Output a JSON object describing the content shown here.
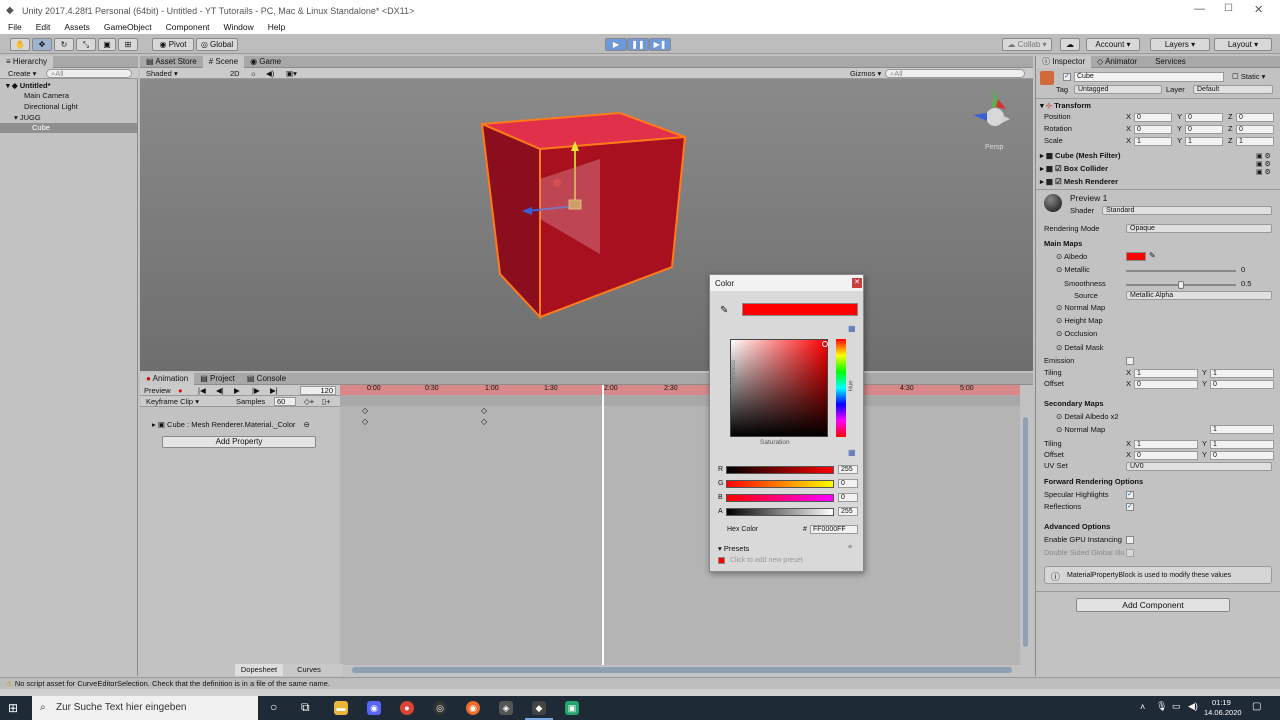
{
  "window": {
    "title": "Unity 2017.4.28f1 Personal (64bit) - Untitled - YT Tutorails - PC, Mac & Linux Standalone* <DX11>"
  },
  "menu": [
    "File",
    "Edit",
    "Assets",
    "GameObject",
    "Component",
    "Window",
    "Help"
  ],
  "toolbar": {
    "pivot": "Pivot",
    "global": "Global",
    "collab": "Collab",
    "account": "Account",
    "layers": "Layers",
    "layout": "Layout"
  },
  "hierarchy": {
    "tab": "Hierarchy",
    "create": "Create",
    "search": "All",
    "scene": "Untitled*",
    "items": [
      "Main Camera",
      "Directional Light",
      "JUGG",
      "Cube"
    ]
  },
  "scene": {
    "tabs": [
      "Asset Store",
      "Scene",
      "Game"
    ],
    "shading": "Shaded",
    "mode2d": "2D",
    "gizmos": "Gizmos",
    "search": "All",
    "persp": "Persp"
  },
  "animation": {
    "tabs": [
      "Animation",
      "Project",
      "Console"
    ],
    "preview": "Preview",
    "frame": "120",
    "clip": "Keyframe Clip",
    "samples_label": "Samples",
    "samples": "60",
    "property": "Cube : Mesh Renderer.Material._Color",
    "add_property": "Add Property",
    "ticks": [
      "0:00",
      "0:30",
      "1:00",
      "1:30",
      "2:00",
      "2:30",
      "4:30",
      "5:00"
    ],
    "dopesheet": "Dopesheet",
    "curves": "Curves"
  },
  "inspector": {
    "tabs": [
      "Inspector",
      "Animator",
      "Services"
    ],
    "object": "Cube",
    "static": "Static",
    "tag_label": "Tag",
    "tag": "Untagged",
    "layer_label": "Layer",
    "layer": "Default",
    "transform": "Transform",
    "position": "Position",
    "rotation": "Rotation",
    "scale": "Scale",
    "pos": [
      "0",
      "0",
      "0"
    ],
    "rot": [
      "0",
      "0",
      "0"
    ],
    "scl": [
      "1",
      "1",
      "1"
    ],
    "mesh_filter": "Cube (Mesh Filter)",
    "box_collider": "Box Collider",
    "mesh_renderer": "Mesh Renderer",
    "material": "Preview 1",
    "shader_label": "Shader",
    "shader": "Standard",
    "rendering_mode_label": "Rendering Mode",
    "rendering_mode": "Opaque",
    "main_maps": "Main Maps",
    "albedo": "Albedo",
    "metallic": "Metallic",
    "metallic_val": "0",
    "smoothness": "Smoothness",
    "smoothness_val": "0.5",
    "source": "Source",
    "source_val": "Metallic Alpha",
    "normal_map": "Normal Map",
    "height_map": "Height Map",
    "occlusion": "Occlusion",
    "detail_mask": "Detail Mask",
    "emission": "Emission",
    "tiling": "Tiling",
    "offset": "Offset",
    "secondary_maps": "Secondary Maps",
    "detail_albedo": "Detail Albedo x2",
    "normal_map2": "Normal Map",
    "normal2_val": "1",
    "uv_set": "UV Set",
    "uv_val": "UV0",
    "fro": "Forward Rendering Options",
    "specular": "Specular Highlights",
    "reflections": "Reflections",
    "advanced": "Advanced Options",
    "gpu": "Enable GPU Instancing",
    "double_sided": "Double Sided Global Illumination",
    "info": "MaterialPropertyBlock is used to modify these values",
    "add_component": "Add Component"
  },
  "color_picker": {
    "title": "Color",
    "brightness": "Brightness",
    "saturation": "Saturation",
    "hue": "Hue",
    "r": "255",
    "g": "0",
    "b": "0",
    "a": "255",
    "hex_label": "Hex Color",
    "hex": "FF0000FF",
    "presets": "Presets",
    "add_preset": "Click to add new preset",
    "color": "#ff0000"
  },
  "status": {
    "message": "No script asset for CurveEditorSelection. Check that the definition is in a file of the same name."
  },
  "taskbar": {
    "search": "Zur Suche Text hier eingeben",
    "time": "01:19",
    "date": "14.06.2020"
  },
  "colors": {
    "accent": "#3d6fb6",
    "red": "#ff0000",
    "cube": "#b8122a"
  }
}
